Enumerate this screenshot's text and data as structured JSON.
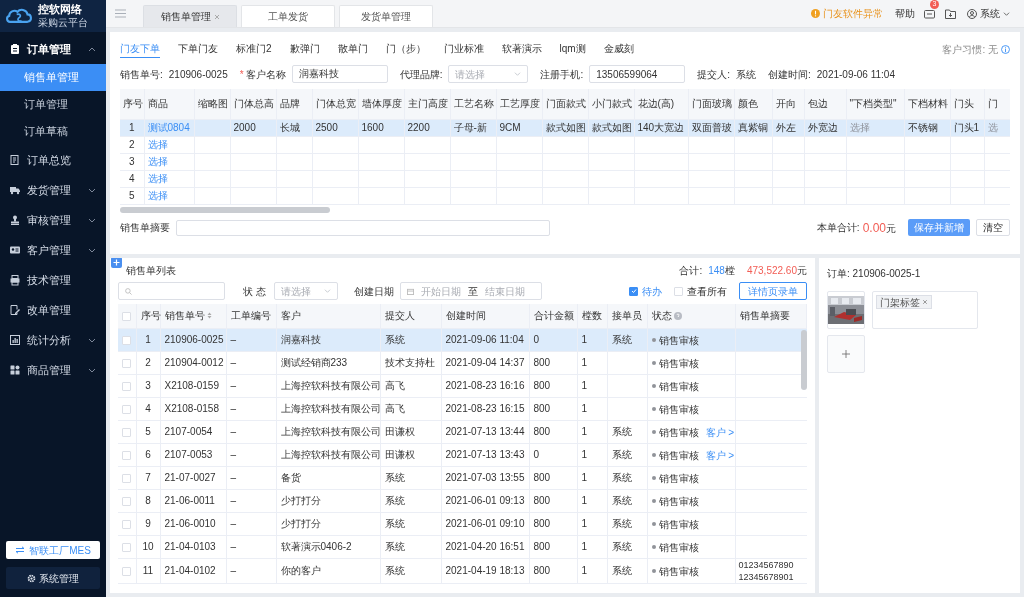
{
  "sidebar": {
    "brand": "控软网络",
    "subtitle": "采购云平台",
    "menu": [
      {
        "label": "订单管理",
        "selected": false,
        "expanded": true,
        "children": [
          {
            "label": "销售单管理",
            "selected": true
          },
          {
            "label": "订单管理",
            "selected": false
          },
          {
            "label": "订单草稿",
            "selected": false
          }
        ]
      },
      {
        "label": "订单总览",
        "selected": false
      },
      {
        "label": "发货管理",
        "selected": false,
        "expanded": false
      },
      {
        "label": "审核管理",
        "selected": false,
        "expanded": false
      },
      {
        "label": "客户管理",
        "selected": false,
        "expanded": false
      },
      {
        "label": "技术管理",
        "selected": false
      },
      {
        "label": "改单管理",
        "selected": false
      },
      {
        "label": "统计分析",
        "selected": false,
        "expanded": false
      },
      {
        "label": "商品管理",
        "selected": false,
        "expanded": false
      }
    ],
    "buttons": [
      "智联工厂MES",
      "系统管理"
    ]
  },
  "topbar": {
    "tabs": [
      {
        "label": "销售单管理",
        "selected": true
      },
      {
        "label": "工单发货",
        "selected": false
      },
      {
        "label": "发货单管理",
        "selected": false
      }
    ],
    "alert": "门友软件异常",
    "help": "帮助",
    "badge": "3",
    "user": "系统"
  },
  "order_form": {
    "tabs": [
      {
        "label": "门友下单",
        "selected": true
      },
      {
        "label": "下单门友",
        "selected": false
      },
      {
        "label": "标准门2",
        "selected": false
      },
      {
        "label": "歉弹门",
        "selected": false
      },
      {
        "label": "散单门",
        "selected": false
      },
      {
        "label": "门（步）",
        "selected": false
      },
      {
        "label": "门业标准",
        "selected": false
      },
      {
        "label": "软著演示",
        "selected": false
      },
      {
        "label": "lqm测",
        "selected": false
      },
      {
        "label": "金威刻",
        "selected": false
      }
    ],
    "customer_habit": "客户习惯: 无",
    "fields": [
      {
        "kind": "text",
        "label": "销售单号:",
        "value": "210906-0025"
      },
      {
        "kind": "input",
        "required_mark": "*",
        "label": "客户名称",
        "value": "润嘉科技"
      },
      {
        "kind": "select",
        "label": "代理品牌:",
        "placeholder": "请选择"
      },
      {
        "kind": "input",
        "label": "注册手机:",
        "value": "13506599064"
      },
      {
        "kind": "text",
        "label": "提交人:",
        "value": "系统"
      },
      {
        "kind": "text",
        "label": "创建时间:",
        "value": "2021-09-06 11:04"
      }
    ],
    "table": {
      "columns": [
        "序号",
        "商品",
        "缩略图",
        "门体总高",
        "品牌",
        "门体总宽",
        "墙体厚度",
        "主门高度",
        "工艺名称",
        "工艺厚度",
        "门面款式",
        "小门款式",
        "花边(高)",
        "门面玻璃",
        "颜色",
        "开向",
        "包边",
        "\"下档类型\"",
        "下档材料",
        "门头",
        "门"
      ],
      "rows": [
        {
          "selected": true,
          "cells": [
            "1",
            {
              "text": "测试0804",
              "kind": "link"
            },
            "",
            "2000",
            "长城",
            "2500",
            "1600",
            "2200",
            "子母-新",
            "9CM",
            "款式如图",
            "款式如图",
            "140大宽边",
            "双面普玻",
            "真紫铜",
            "外左",
            "外宽边",
            {
              "text": "选择",
              "kind": "placeholder"
            },
            "不锈钢",
            "门头1",
            {
              "text": "选",
              "kind": "placeholder"
            }
          ]
        },
        {
          "selected": false,
          "cells": [
            "2",
            {
              "text": "选择",
              "kind": "link"
            }
          ]
        },
        {
          "selected": false,
          "cells": [
            "3",
            {
              "text": "选择",
              "kind": "link"
            }
          ]
        },
        {
          "selected": false,
          "cells": [
            "4",
            {
              "text": "选择",
              "kind": "link"
            }
          ]
        },
        {
          "selected": false,
          "cells": [
            "5",
            {
              "text": "选择",
              "kind": "link"
            }
          ]
        }
      ]
    },
    "summary_label": "销售单摘要",
    "total_label": "本单合计:",
    "total": "0.00",
    "total_unit": "元",
    "buttons": [
      "保存并新增",
      "清空"
    ]
  },
  "list": {
    "title": "销售单列表",
    "total_label": "合计:",
    "count": "148",
    "count_unit": "樘",
    "amount": "473,522.60",
    "amount_unit": "元",
    "status_label": "状 态",
    "status_placeholder": "请选择",
    "date_label": "创建日期",
    "date_start": "开始日期",
    "date_sep": "至",
    "date_end": "结束日期",
    "checks": [
      {
        "label": "待办",
        "checked": true
      },
      {
        "label": "查看所有",
        "checked": false
      }
    ],
    "button": "详情页录单",
    "select_all_checked": false,
    "columns": [
      {
        "label": "序号",
        "kind": "text"
      },
      {
        "label": "销售单号",
        "kind": "sort"
      },
      {
        "label": "工单编号",
        "kind": "text"
      },
      {
        "label": "客户",
        "kind": "text"
      },
      {
        "label": "提交人",
        "kind": "text"
      },
      {
        "label": "创建时间",
        "kind": "text"
      },
      {
        "label": "合计金额",
        "kind": "text"
      },
      {
        "label": "樘数",
        "kind": "text"
      },
      {
        "label": "接单员",
        "kind": "text"
      },
      {
        "label": "状态",
        "kind": "help"
      },
      {
        "label": "销售单摘要",
        "kind": "text"
      }
    ],
    "rows": [
      {
        "selected": true,
        "checked": false,
        "cells": [
          "1",
          "210906-0025",
          "–",
          "润嘉科技",
          "系统",
          "2021-09-06 11:04",
          "0",
          "1",
          "系统"
        ],
        "status": "销售审核"
      },
      {
        "selected": false,
        "checked": false,
        "cells": [
          "2",
          "210904-0012",
          "–",
          "测试经销商233",
          "技术支持杜",
          "2021-09-04 14:37",
          "800",
          "1",
          ""
        ],
        "status": "销售审核"
      },
      {
        "selected": false,
        "checked": false,
        "cells": [
          "3",
          "X2108-0159",
          "–",
          "上海控软科技有限公司",
          "高飞",
          "2021-08-23 16:16",
          "800",
          "1",
          ""
        ],
        "status": "销售审核"
      },
      {
        "selected": false,
        "checked": false,
        "cells": [
          "4",
          "X2108-0158",
          "–",
          "上海控软科技有限公司",
          "高飞",
          "2021-08-23 16:15",
          "800",
          "1",
          ""
        ],
        "status": "销售审核"
      },
      {
        "selected": false,
        "checked": false,
        "cells": [
          "5",
          "2107-0054",
          "–",
          "上海控软科技有限公司",
          "田谦权",
          "2021-07-13 13:44",
          "800",
          "1",
          "系统"
        ],
        "status": "销售审核",
        "link": "客户 >"
      },
      {
        "selected": false,
        "checked": false,
        "cells": [
          "6",
          "2107-0053",
          "–",
          "上海控软科技有限公司",
          "田谦权",
          "2021-07-13 13:43",
          "0",
          "1",
          "系统"
        ],
        "status": "销售审核",
        "link": "客户 >"
      },
      {
        "selected": false,
        "checked": false,
        "cells": [
          "7",
          "21-07-0027",
          "–",
          "备货",
          "系统",
          "2021-07-03 13:55",
          "800",
          "1",
          "系统"
        ],
        "status": "销售审核"
      },
      {
        "selected": false,
        "checked": false,
        "cells": [
          "8",
          "21-06-0011",
          "–",
          "少打打分",
          "系统",
          "2021-06-01 09:13",
          "800",
          "1",
          "系统"
        ],
        "status": "销售审核"
      },
      {
        "selected": false,
        "checked": false,
        "cells": [
          "9",
          "21-06-0010",
          "–",
          "少打打分",
          "系统",
          "2021-06-01 09:10",
          "800",
          "1",
          "系统"
        ],
        "status": "销售审核"
      },
      {
        "selected": false,
        "checked": false,
        "cells": [
          "10",
          "21-04-0103",
          "–",
          "软著演示0406-2",
          "系统",
          "2021-04-20 16:51",
          "800",
          "1",
          "系统"
        ],
        "status": "销售审核"
      },
      {
        "selected": false,
        "checked": false,
        "cells": [
          "11",
          "21-04-0102",
          "–",
          "你的客户",
          "系统",
          "2021-04-19 18:13",
          "800",
          "1",
          "系统"
        ],
        "status": "销售审核",
        "summary": "0123456789012345678901"
      }
    ]
  },
  "detail": {
    "order_label": "订单: 210906-0025-1",
    "picture": {
      "kind": "picture"
    },
    "tags": [
      "门架标签"
    ]
  }
}
